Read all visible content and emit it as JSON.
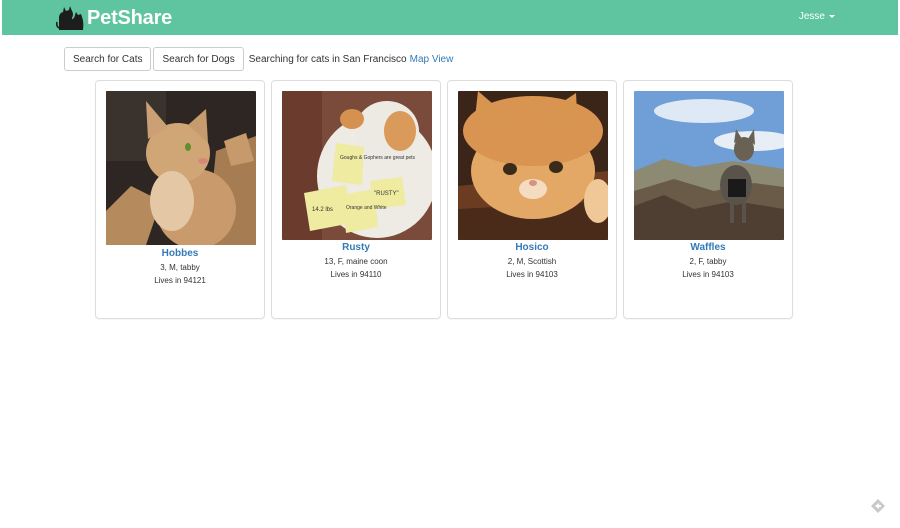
{
  "header": {
    "brand": "PetShare",
    "user": "Jesse",
    "colors": {
      "navbar": "#5fc4a0",
      "link": "#337ab7"
    },
    "icons": {
      "logo": "cat-and-dog-logo-icon",
      "menu": "caret-down-icon"
    }
  },
  "toolbar": {
    "search_cats": "Search for Cats",
    "search_dogs": "Search for Dogs",
    "status": "Searching for cats in San Francisco",
    "map_view": "Map View"
  },
  "pets": [
    {
      "name": "Hobbes",
      "info": "3, M, tabby",
      "location": "Lives in 94121",
      "photo": "orange tabby cat sitting in a cardboard box"
    },
    {
      "name": "Rusty",
      "info": "13, F, maine coon",
      "location": "Lives in 94110",
      "photo": "cat lying on back covered in sticky notes",
      "notes": [
        "Goughs & Gophers are great pets",
        "14.2 lbs",
        "Orange and White",
        "\"RUSTY\""
      ]
    },
    {
      "name": "Hosico",
      "info": "2, M, Scottish",
      "location": "Lives in 94103",
      "photo": "orange cat resting head on a couch"
    },
    {
      "name": "Waffles",
      "info": "2, F, tabby",
      "location": "Lives in 94103",
      "photo": "tabby cat in harness standing on rocks"
    }
  ]
}
